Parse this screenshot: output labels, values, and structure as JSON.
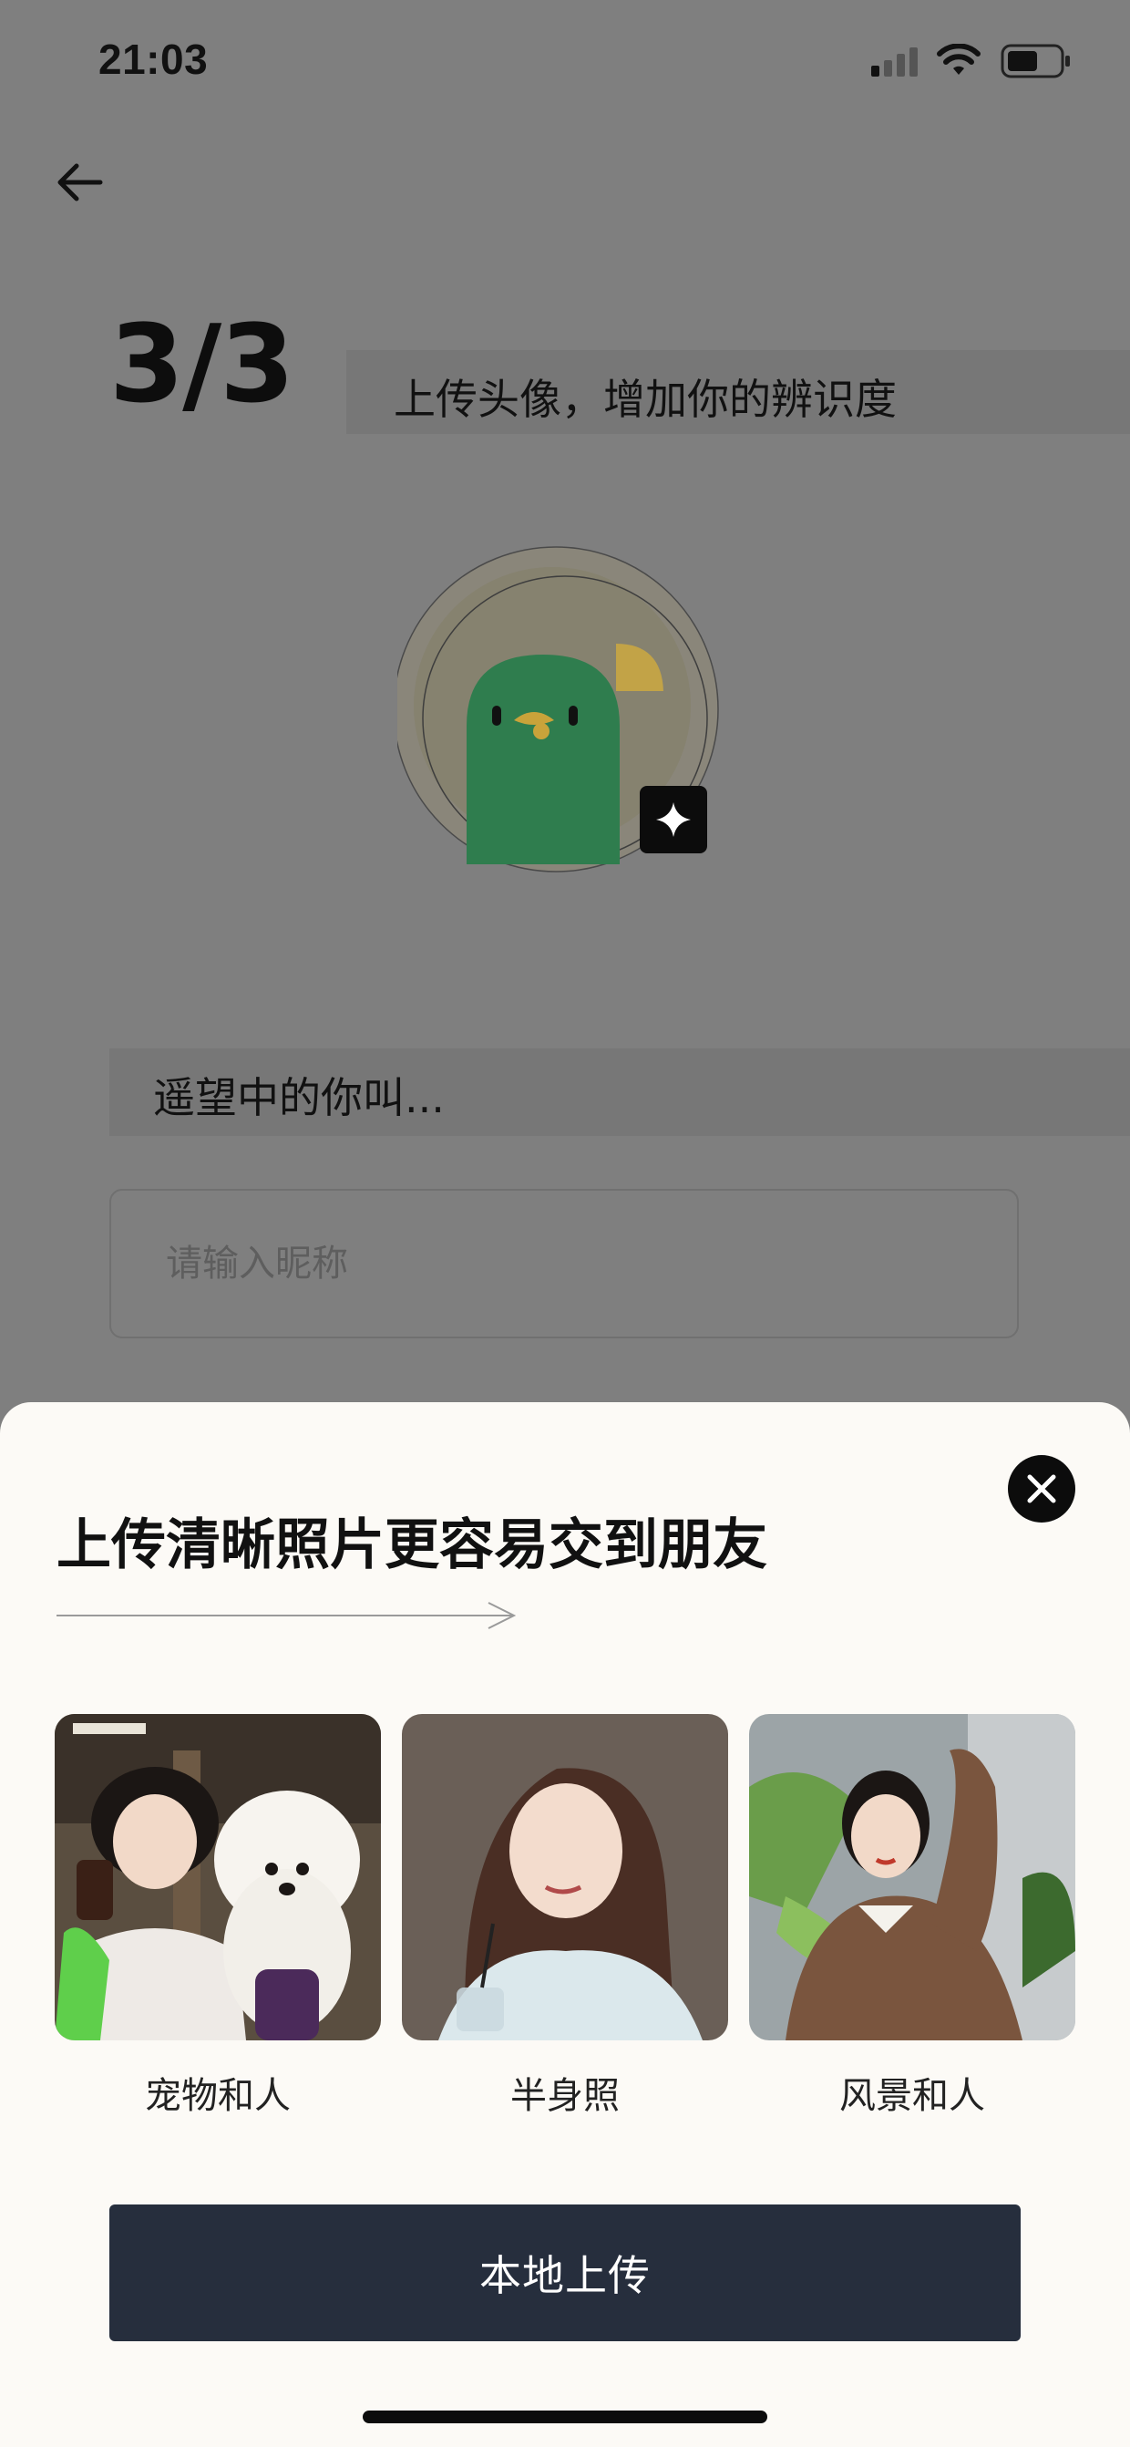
{
  "status_bar": {
    "time": "21:03",
    "icons": [
      "cellular-signal-icon",
      "wifi-icon",
      "battery-icon"
    ]
  },
  "nav": {
    "back_icon": "arrow-left-icon"
  },
  "step": {
    "number": "3/3",
    "description": "上传头像，增加你的辨识度"
  },
  "avatar": {
    "icon": "green-bird-avatar",
    "badge_icon": "sparkle-icon"
  },
  "name_section": {
    "label": "遥望中的你叫...",
    "placeholder": "请输入昵称"
  },
  "sheet": {
    "title": "上传清晰照片更容易交到朋友",
    "close_icon": "close-icon",
    "examples": [
      {
        "caption": "宠物和人"
      },
      {
        "caption": "半身照"
      },
      {
        "caption": "风景和人"
      }
    ],
    "upload_label": "本地上传"
  },
  "colors": {
    "overlay": "#7f7f7f",
    "sheet_bg": "#fcfaf6",
    "button_bg": "#262e3d",
    "avatar_green": "#2f7d4e",
    "avatar_beak": "#c9a33a"
  }
}
